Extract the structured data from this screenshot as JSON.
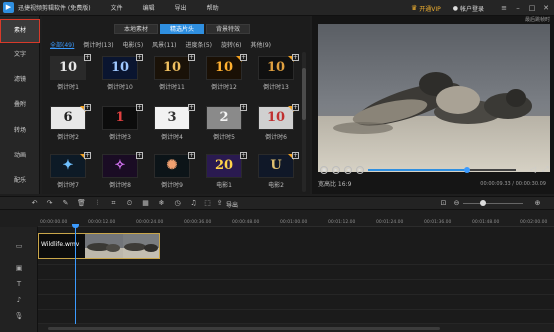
{
  "app": {
    "title": "迅捷视频剪辑软件 (免费版)",
    "menu": [
      "文件",
      "编辑",
      "导出",
      "帮助"
    ],
    "vip_label": "开通VIP",
    "login_label": "帐户登录"
  },
  "leftnav": [
    "素材",
    "文字",
    "滤镜",
    "叠附",
    "转场",
    "动画",
    "配乐"
  ],
  "source_tabs": [
    "本地素材",
    "精选片头",
    "背景特效"
  ],
  "filters": [
    "全部(49)",
    "倒计时(13)",
    "电影(5)",
    "风景(11)",
    "进度条(5)",
    "旋转(6)",
    "其他(9)"
  ],
  "tiles": [
    {
      "label": "倒计时1",
      "glyph": "10"
    },
    {
      "label": "倒计时10",
      "glyph": "10"
    },
    {
      "label": "倒计时11",
      "glyph": "10"
    },
    {
      "label": "倒计时12",
      "glyph": "10"
    },
    {
      "label": "倒计时13",
      "glyph": "10"
    },
    {
      "label": "倒计时2",
      "glyph": "6"
    },
    {
      "label": "倒计时3",
      "glyph": "1"
    },
    {
      "label": "倒计时4",
      "glyph": "3"
    },
    {
      "label": "倒计时5",
      "glyph": "2"
    },
    {
      "label": "倒计时6",
      "glyph": "10"
    },
    {
      "label": "倒计时7",
      "glyph": "✦"
    },
    {
      "label": "倒计时8",
      "glyph": "✧"
    },
    {
      "label": "倒计时9",
      "glyph": "✺"
    },
    {
      "label": "电影1",
      "glyph": "20"
    },
    {
      "label": "电影2",
      "glyph": "U"
    }
  ],
  "preview": {
    "top_label": "最后跳帧时",
    "ratio_label": "宽高比 16:9",
    "time_current": "00:00:09.33",
    "time_total": "00:00:30.09",
    "progress": 0.67
  },
  "toolbar": {
    "export_label": "导出"
  },
  "ruler_ticks": [
    "00:00:00.00",
    "00:00:12.00",
    "00:00:24.00",
    "00:00:36.00",
    "00:00:48.00",
    "00:01:00.00",
    "00:01:12.00",
    "00:01:24.00",
    "00:01:36.00",
    "00:01:48.00",
    "00:02:00.00"
  ],
  "timeline": {
    "clip_name": "Wildlife.wmv"
  },
  "colors": {
    "accent": "#2f8fe0",
    "nav_active_outline": "#d83a2a",
    "clip_border": "#c9a64a",
    "vip": "#f0b030"
  }
}
